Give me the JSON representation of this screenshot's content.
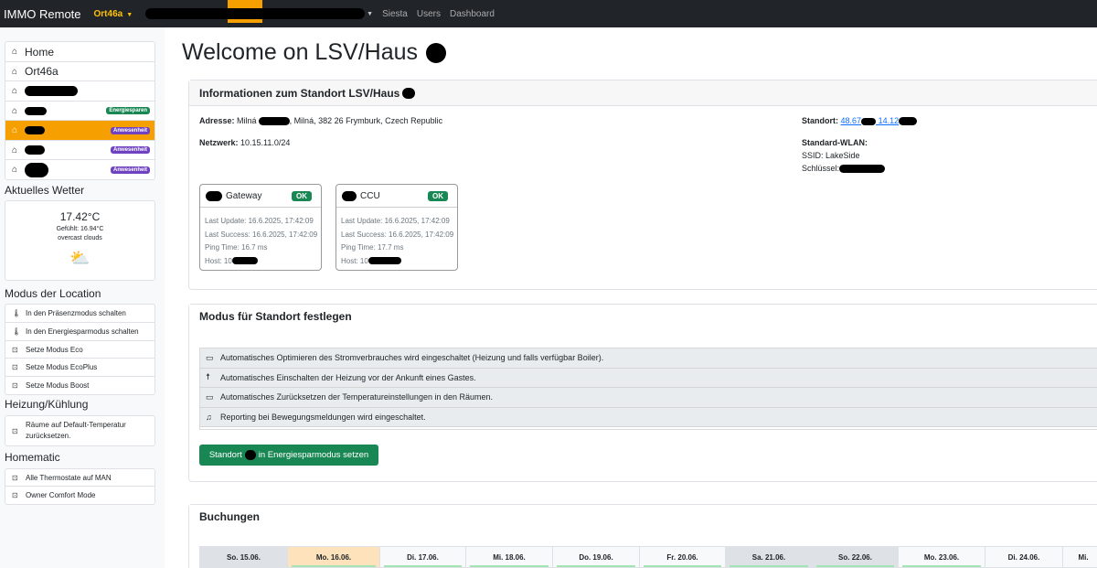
{
  "navbar": {
    "brand": "IMMO Remote",
    "location_dropdown": "Ort46a",
    "links": [
      "Siesta",
      "Users",
      "Dashboard"
    ]
  },
  "sidebar": {
    "locations": [
      {
        "label": "Home",
        "icon": "home-icon",
        "badge": ""
      },
      {
        "label": "Ort46a",
        "icon": "home-icon",
        "badge": ""
      },
      {
        "label": "",
        "icon": "home-icon",
        "badge": ""
      },
      {
        "label": "",
        "icon": "home-icon",
        "badge": "Energiesparen"
      },
      {
        "label": "",
        "icon": "home-icon",
        "badge": "Anwesenheit"
      },
      {
        "label": "",
        "icon": "home-icon",
        "badge": "Anwesenheit"
      },
      {
        "label": "",
        "icon": "home-icon",
        "badge": "Anwesenheit"
      }
    ],
    "weather": {
      "heading": "Aktuelles Wetter",
      "temp": "17.42°C",
      "feels": "Gefühlt: 16.94°C",
      "desc": "overcast clouds",
      "icon": "cloud-sun-icon"
    },
    "mode": {
      "heading": "Modus der Location",
      "items": [
        "In den Präsenzmodus schalten",
        "In den Energiesparmodus schalten",
        "Setze Modus Eco",
        "Setze Modus EcoPlus",
        "Setze Modus Boost"
      ]
    },
    "heating": {
      "heading": "Heizung/Kühlung",
      "items": [
        "Räume auf Default-Temperatur zurücksetzen."
      ]
    },
    "homematic": {
      "heading": "Homematic",
      "items": [
        "Alle Thermostate auf MAN",
        "Owner Comfort Mode"
      ]
    }
  },
  "main": {
    "title": "Welcome on LSV/Haus",
    "info": {
      "header": "Informationen zum Standort LSV/Haus",
      "address_label": "Adresse:",
      "address_value_pre": "Milná",
      "address_value_post": ", Milná, 382 26 Frymburk, Czech Republic",
      "network_label": "Netzwerk:",
      "network_value": "10.15.11.0/24",
      "location_label": "Standort:",
      "location_lat": "48.67",
      "location_lon": "14.12",
      "wlan_label": "Standard-WLAN:",
      "ssid": "SSID: LakeSide",
      "key_label": "Schlüssel:"
    },
    "devices": [
      {
        "name": "Gateway",
        "status": "OK",
        "last_update": "Last Update: 16.6.2025, 17:42:09",
        "last_success": "Last Success: 16.6.2025, 17:42:09",
        "ping": "Ping Time: 16.7 ms",
        "host": "Host: 10"
      },
      {
        "name": "CCU",
        "status": "OK",
        "last_update": "Last Update: 16.6.2025, 17:42:09",
        "last_success": "Last Success: 16.6.2025, 17:42:09",
        "ping": "Ping Time: 17.7 ms",
        "host": "Host: 10"
      }
    ],
    "mode_card": {
      "header": "Modus für Standort festlegen",
      "items": [
        {
          "icon": "toggle-icon",
          "text": "Automatisches Optimieren des Stromverbrauches wird eingeschaltet (Heizung und falls verfügbar Boiler)."
        },
        {
          "icon": "person-icon",
          "text": "Automatisches Einschalten der Heizung vor der Ankunft eines Gastes."
        },
        {
          "icon": "toggle-icon",
          "text": "Automatisches Zurücksetzen der Temperatureinstellungen in den Räumen."
        },
        {
          "icon": "bell-icon",
          "text": "Reporting bei Bewegungsmeldungen wird eingeschaltet."
        }
      ],
      "button_pre": "Standort",
      "button_post": "in Energiesparmodus setzen"
    },
    "bookings": {
      "header": "Buchungen",
      "days": [
        "So. 15.06.",
        "Mo. 16.06.",
        "Di. 17.06.",
        "Mi. 18.06.",
        "Do. 19.06.",
        "Fr. 20.06.",
        "Sa. 21.06.",
        "So. 22.06.",
        "Mo. 23.06.",
        "Di. 24.06.",
        "Mi."
      ]
    }
  }
}
